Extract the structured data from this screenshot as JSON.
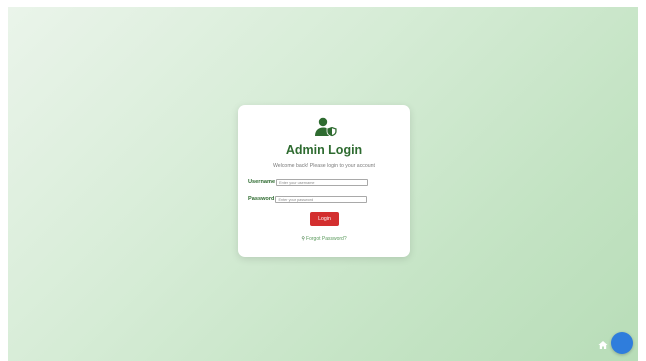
{
  "login": {
    "title": "Admin Login",
    "subtitle": "Welcome back! Please login to your account",
    "username_label": "Username",
    "username_placeholder": "Enter your username",
    "password_label": "Password",
    "password_placeholder": "Enter your password",
    "login_button": "Login",
    "forgot_password": "Forgot Password?"
  },
  "icons": {
    "admin": "user-shield-icon",
    "key": "key-icon",
    "home": "home-icon",
    "fab": "chat-bubble"
  },
  "colors": {
    "accent_green": "#2e6b30",
    "button_red": "#d32f2f",
    "fab_blue": "#2f7ddc",
    "background_start": "#eaf4ea",
    "background_end": "#b8ddb8"
  }
}
